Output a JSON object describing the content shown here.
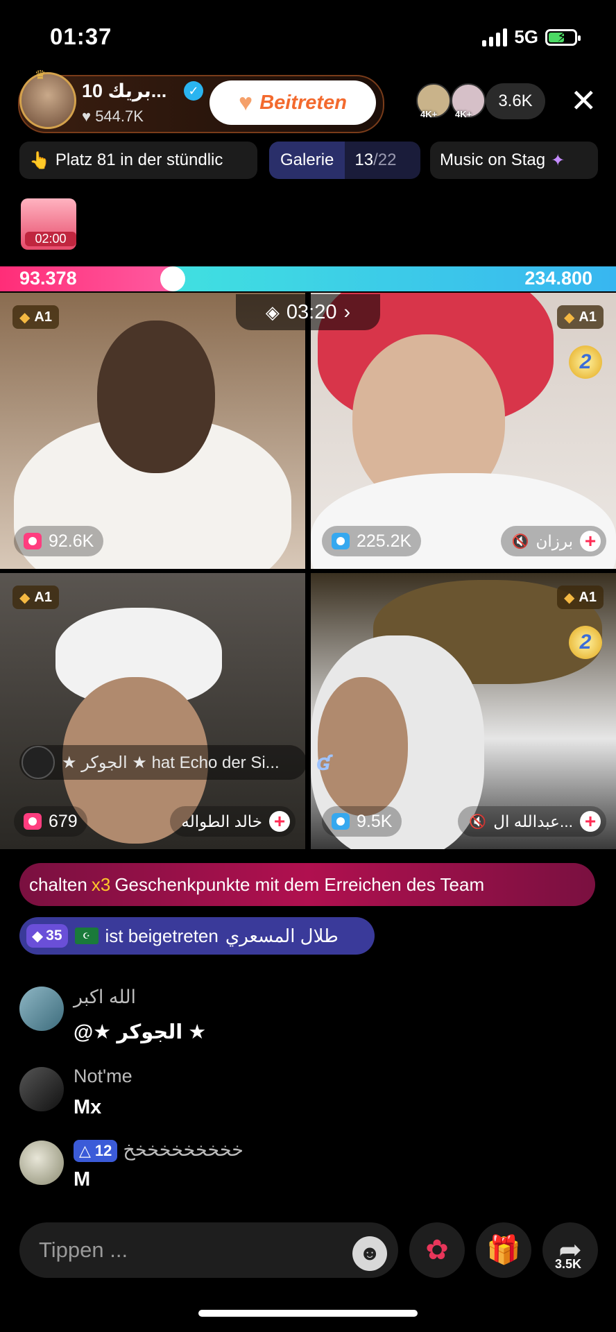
{
  "status": {
    "time": "01:37",
    "network": "5G"
  },
  "host": {
    "name": "بريك 10...",
    "likes": "544.7K",
    "join_label": "Beitreten"
  },
  "viewers": {
    "badge": "4K+",
    "count": "3.6K"
  },
  "pills": {
    "rank": "Platz 81 in der stündlic",
    "gallery_label": "Galerie",
    "gallery_current": "13",
    "gallery_total": "/22",
    "music": "Music on Stag"
  },
  "chest_timer": "02:00",
  "battle": {
    "left_score": "93.378",
    "right_score": "234.800",
    "timer": "03:20",
    "left_fraction": 0.28
  },
  "tiles": [
    {
      "badge": "A1",
      "count": "92.6K",
      "name": ""
    },
    {
      "badge": "A1",
      "count": "225.2K",
      "name": "برزان",
      "rank": "2"
    },
    {
      "badge": "A1",
      "count": "679",
      "name": "خالد الطواله"
    },
    {
      "badge": "A1",
      "count": "9.5K",
      "name": "عبدالله ال...",
      "rank": "2"
    }
  ],
  "echo": {
    "text": "★ الجوكر ★ hat Echo der Si..."
  },
  "banner": {
    "pre": "chalten ",
    "mult": "x3",
    "post": "Geschenkpunkte mit dem Erreichen des Team"
  },
  "joined": {
    "level": "35",
    "text": "ist beigetreten",
    "user": "طلال المسعري"
  },
  "chat": [
    {
      "name": "الله اكبر",
      "message": "@★ الجوكر ★"
    },
    {
      "name": "Not'me",
      "message": "Mx"
    },
    {
      "level": "12",
      "name": "خخخخخخخخخخ",
      "message": "M"
    }
  ],
  "bottom": {
    "placeholder": "Tippen ...",
    "share_count": "3.5K"
  },
  "colors": {
    "pink": "#ff2d78",
    "cyan": "#40e0e0",
    "join": "#f36a2e"
  }
}
